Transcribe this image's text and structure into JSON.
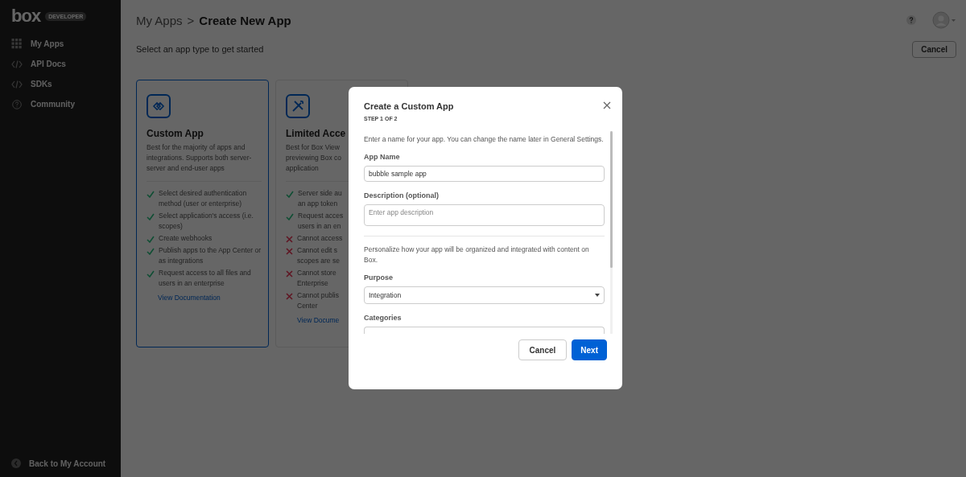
{
  "sidebar": {
    "logo": "box",
    "badge": "DEVELOPER",
    "items": [
      {
        "label": "My Apps"
      },
      {
        "label": "API Docs"
      },
      {
        "label": "SDKs"
      },
      {
        "label": "Community"
      }
    ],
    "footer": "Back to My Account"
  },
  "header": {
    "breadcrumb": [
      {
        "label": "My Apps",
        "current": false
      },
      {
        "label": "Create New App",
        "current": true
      }
    ],
    "separator": ">",
    "cancel": "Cancel"
  },
  "subtitle": "Select an app type to get started",
  "cards": [
    {
      "title": "Custom App",
      "selected": true,
      "description": [
        "Best for the majority of apps and integrations. Supports both server-server and end-user apps"
      ],
      "features": [
        {
          "ok": true,
          "lines": [
            "Select desired authentication method (user or enterprise)"
          ]
        },
        {
          "ok": true,
          "lines": [
            "Select application's access (i.e. scopes)"
          ]
        },
        {
          "ok": true,
          "lines": [
            "Create webhooks"
          ]
        },
        {
          "ok": true,
          "lines": [
            "Publish apps to the App Center or as integrations"
          ]
        },
        {
          "ok": true,
          "lines": [
            "Request access to all files and users in an enterprise"
          ]
        }
      ],
      "link": "View Documentation"
    },
    {
      "title": "Limited Acce",
      "selected": false,
      "description": [
        "Best for Box View",
        "previewing Box co",
        "application"
      ],
      "features": [
        {
          "ok": true,
          "lines": [
            "Server side au",
            "an app token"
          ]
        },
        {
          "ok": true,
          "lines": [
            "Request acces",
            "users in an en"
          ]
        },
        {
          "ok": false,
          "lines": [
            "Cannot access"
          ]
        },
        {
          "ok": false,
          "lines": [
            "Cannot edit s",
            "scopes are se"
          ]
        },
        {
          "ok": false,
          "lines": [
            "Cannot store",
            "Enterprise"
          ]
        },
        {
          "ok": false,
          "lines": [
            "Cannot publis",
            "Center"
          ]
        }
      ],
      "link": "View Docume"
    }
  ],
  "modal": {
    "title": "Create a Custom App",
    "step": "STEP 1 OF 2",
    "intro": "Enter a name for your app. You can change the name later in General Settings.",
    "app_name": {
      "label": "App Name",
      "value": "bubble sample app"
    },
    "description": {
      "label": "Description (optional)",
      "placeholder": "Enter app description"
    },
    "personalize": "Personalize how your app will be organized and integrated with content on Box.",
    "purpose": {
      "label": "Purpose",
      "value": "Integration"
    },
    "categories": {
      "label": "Categories"
    },
    "buttons": [
      {
        "label": "Cancel",
        "kind": "secondary"
      },
      {
        "label": "Next",
        "kind": "primary"
      }
    ]
  }
}
